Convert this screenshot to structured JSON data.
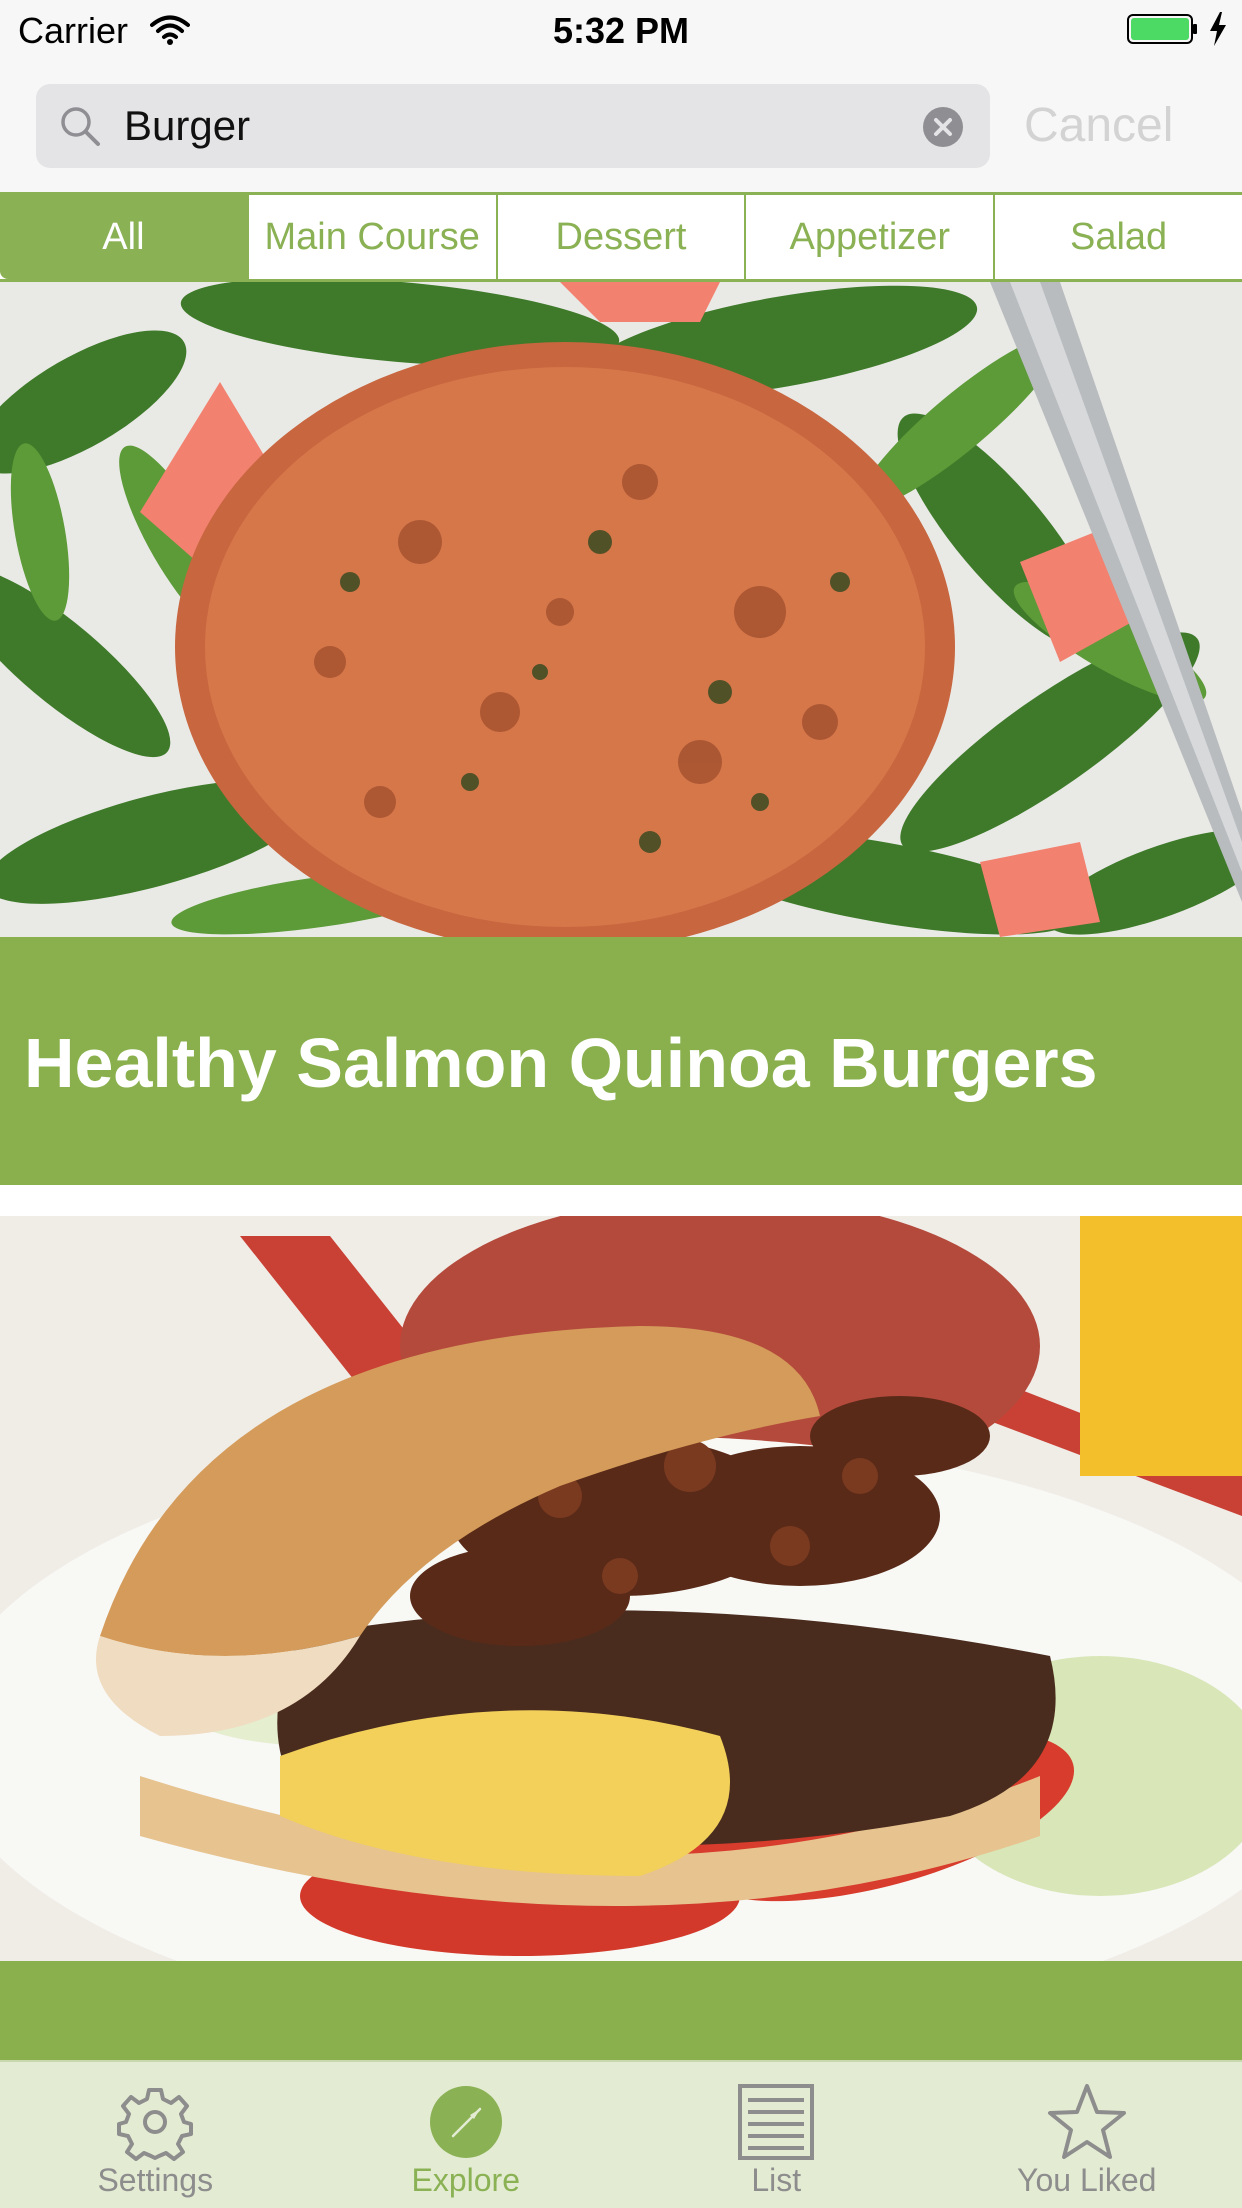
{
  "status_bar": {
    "carrier": "Carrier",
    "time": "5:32 PM",
    "icons": [
      "wifi-icon",
      "battery-icon",
      "charging-bolt-icon"
    ],
    "battery_color": "#4cd964"
  },
  "search": {
    "value": "Burger",
    "cancel_label": "Cancel",
    "icons": [
      "search-icon",
      "clear-icon"
    ]
  },
  "segments": {
    "items": [
      {
        "label": "All",
        "selected": true
      },
      {
        "label": "Main Course",
        "selected": false
      },
      {
        "label": "Dessert",
        "selected": false
      },
      {
        "label": "Appetizer",
        "selected": false
      },
      {
        "label": "Salad",
        "selected": false
      }
    ],
    "accent_color": "#8bb155"
  },
  "recipes": [
    {
      "title": "Healthy Salmon Quinoa Burgers",
      "image": "salmon-burger-photo"
    },
    {
      "title": "",
      "image": "cheeseburger-photo"
    }
  ],
  "tab_bar": {
    "items": [
      {
        "label": "Settings",
        "icon": "gear-icon",
        "active": false
      },
      {
        "label": "Explore",
        "icon": "compass-icon",
        "active": true
      },
      {
        "label": "List",
        "icon": "list-icon",
        "active": false
      },
      {
        "label": "You Liked",
        "icon": "star-icon",
        "active": false
      }
    ],
    "background": "#e3ecd3"
  }
}
